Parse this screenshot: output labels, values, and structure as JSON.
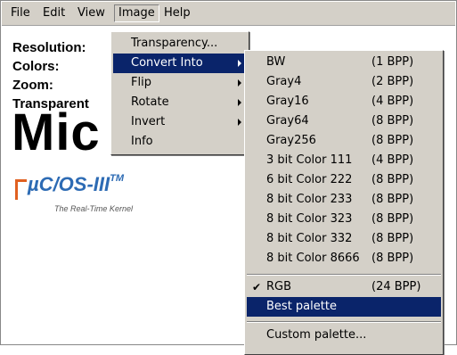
{
  "menubar": {
    "items": [
      {
        "label": "File"
      },
      {
        "label": "Edit"
      },
      {
        "label": "View"
      },
      {
        "label": "Image"
      },
      {
        "label": "Help"
      }
    ]
  },
  "info": {
    "resolution": "Resolution:",
    "colors": "Colors:",
    "zoom": "Zoom:",
    "transparent": "Transparent"
  },
  "logo": {
    "big_text": "Mic",
    "product": "µC/OS-III",
    "trademark": "TM",
    "tagline": "The Real-Time Kernel"
  },
  "image_menu": {
    "items": [
      {
        "label": "Transparency..."
      },
      {
        "label": "Convert Into"
      },
      {
        "label": "Flip"
      },
      {
        "label": "Rotate"
      },
      {
        "label": "Invert"
      },
      {
        "label": "Info"
      }
    ]
  },
  "convert_submenu": {
    "items": [
      {
        "label": "BW",
        "bpp": "(1 BPP)"
      },
      {
        "label": "Gray4",
        "bpp": "(2 BPP)"
      },
      {
        "label": "Gray16",
        "bpp": "(4 BPP)"
      },
      {
        "label": "Gray64",
        "bpp": "(8 BPP)"
      },
      {
        "label": "Gray256",
        "bpp": "(8 BPP)"
      },
      {
        "label": "3 bit Color 111",
        "bpp": "(4 BPP)"
      },
      {
        "label": "6 bit Color 222",
        "bpp": "(8 BPP)"
      },
      {
        "label": "8 bit Color 233",
        "bpp": "(8 BPP)"
      },
      {
        "label": "8 bit Color 323",
        "bpp": "(8 BPP)"
      },
      {
        "label": "8 bit Color 332",
        "bpp": "(8 BPP)"
      },
      {
        "label": "8 bit Color 8666",
        "bpp": "(8 BPP)"
      }
    ],
    "rgb": {
      "label": "RGB",
      "bpp": "(24 BPP)",
      "check": "✔"
    },
    "best_palette": {
      "label": "Best palette"
    },
    "custom_palette": {
      "label": "Custom palette..."
    }
  }
}
